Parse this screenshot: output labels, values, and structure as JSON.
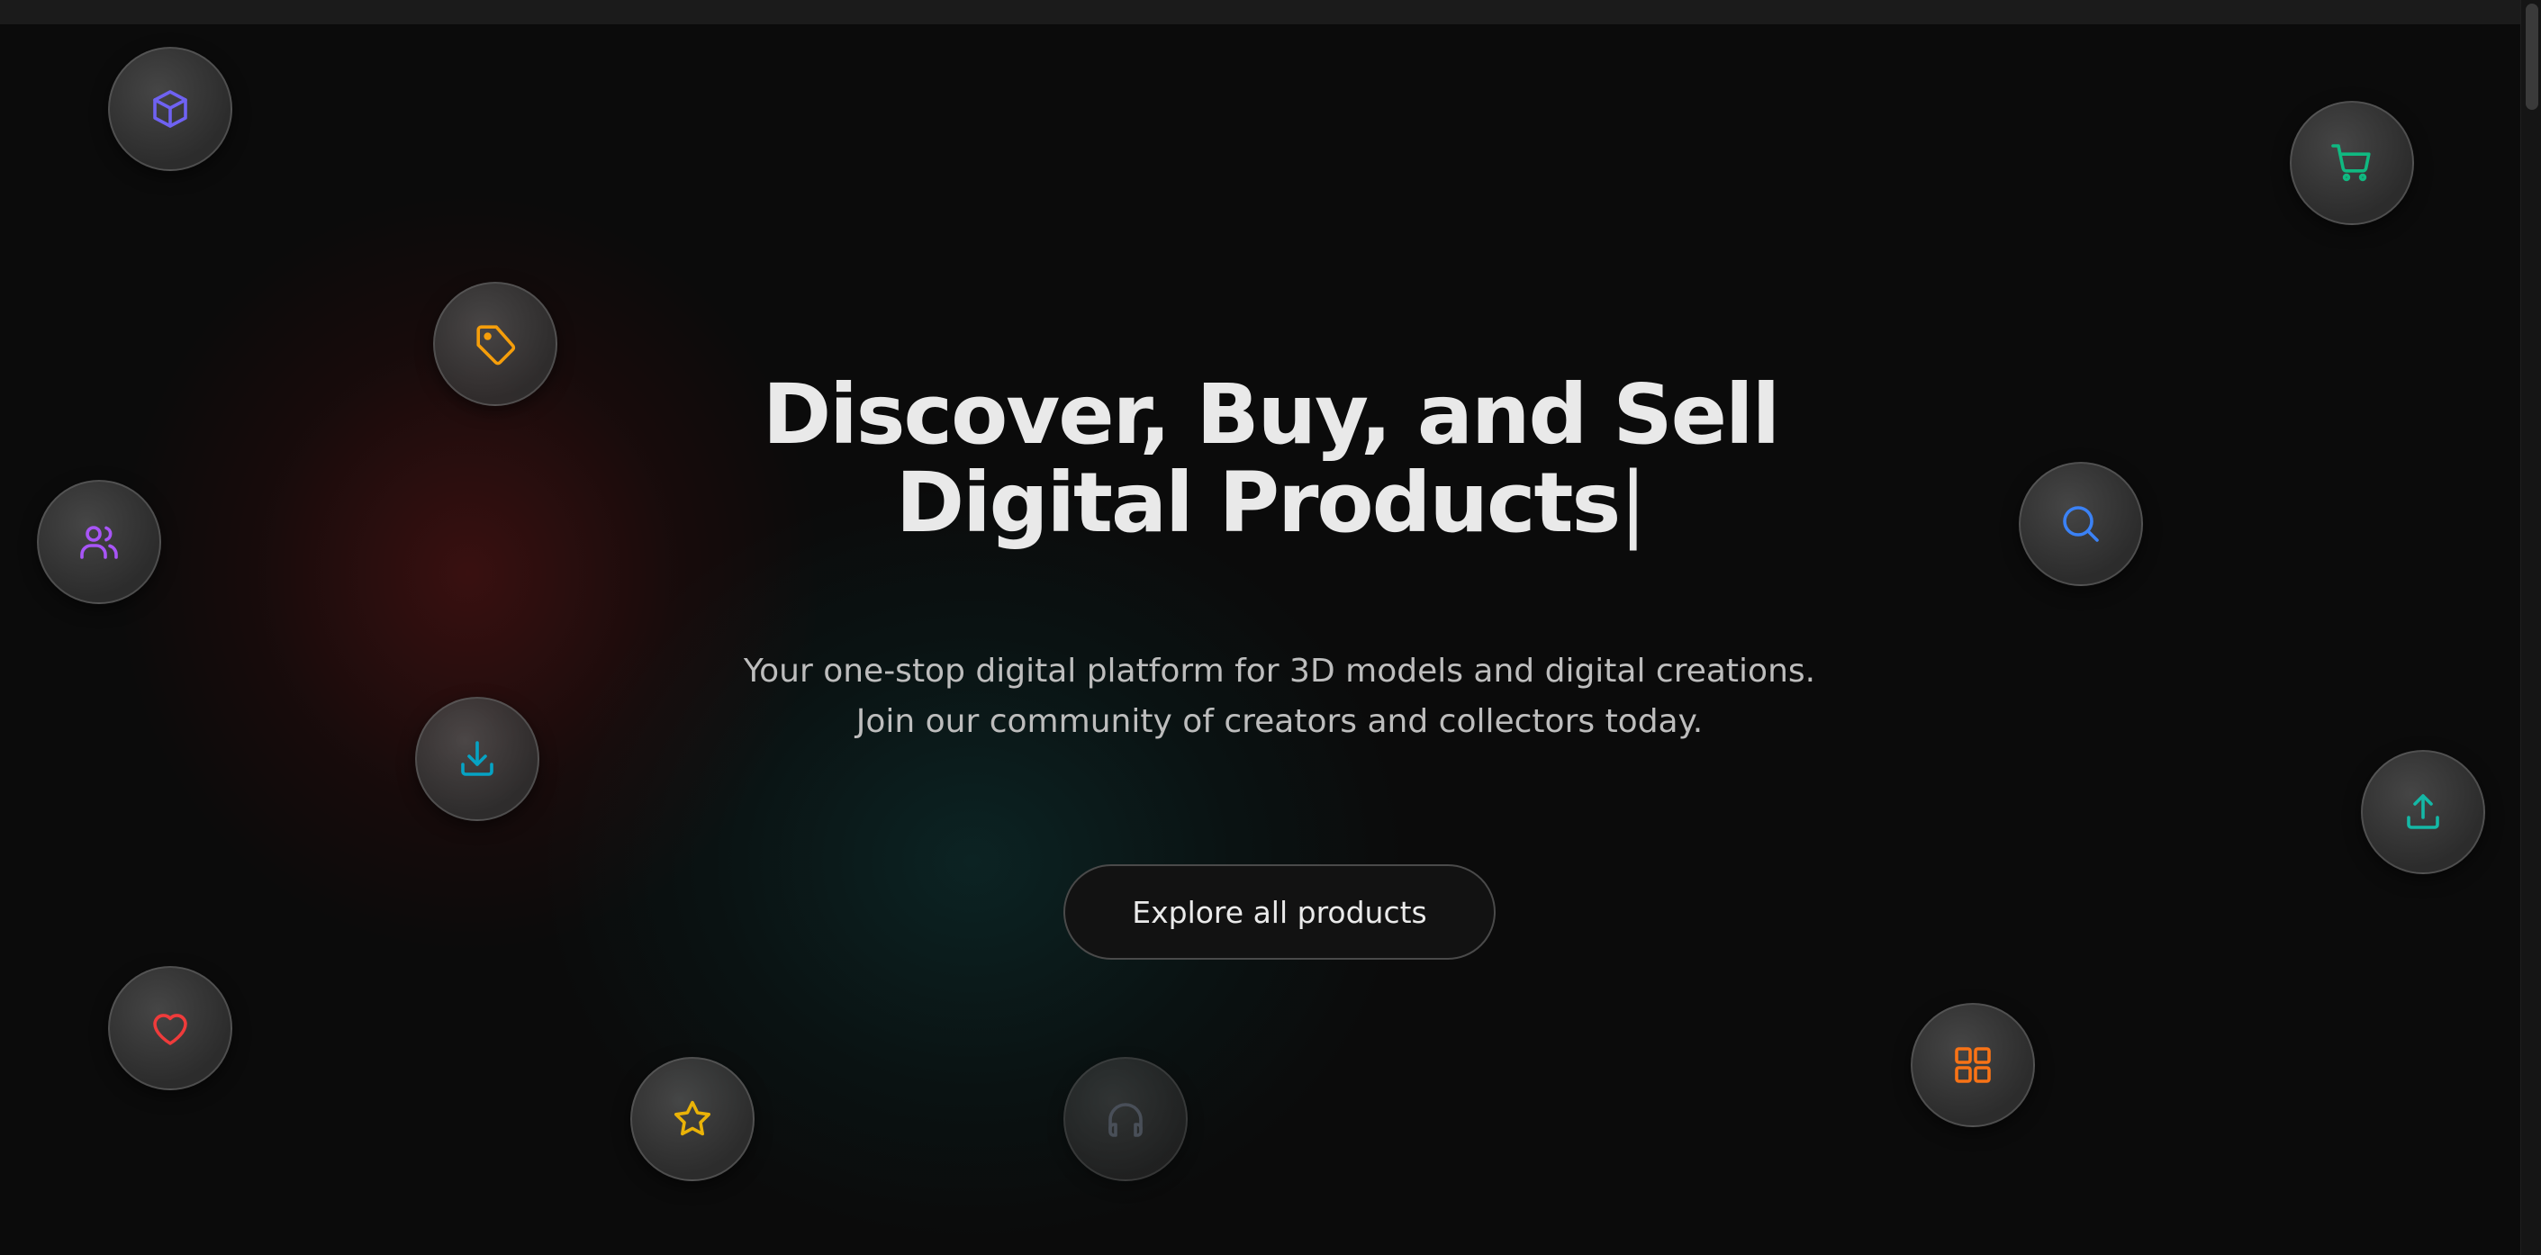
{
  "hero": {
    "headline_line1": "Discover, Buy, and Sell",
    "headline_line2": "Digital Products",
    "cursor": "|",
    "subtitle_line1": "Your one-stop digital platform for 3D models and digital creations.",
    "subtitle_line2": "Join our community of creators and collectors today.",
    "cta_label": "Explore all products"
  },
  "floating_icons": [
    {
      "icon": "cube-icon",
      "color": "#6f62f2"
    },
    {
      "icon": "tag-icon",
      "color": "#f59e0b"
    },
    {
      "icon": "users-icon",
      "color": "#a855f7"
    },
    {
      "icon": "download-icon",
      "color": "#06a3c4"
    },
    {
      "icon": "heart-icon",
      "color": "#ef3b3b"
    },
    {
      "icon": "star-icon",
      "color": "#eab308"
    },
    {
      "icon": "headphones-icon",
      "color": "#6b7280"
    },
    {
      "icon": "cart-icon",
      "color": "#10b981"
    },
    {
      "icon": "search-icon",
      "color": "#3b82f6"
    },
    {
      "icon": "upload-icon",
      "color": "#14b8a6"
    },
    {
      "icon": "grid-icon",
      "color": "#f97316"
    }
  ],
  "colors": {
    "background": "#0b0b0b",
    "text_primary": "#e9e9e9",
    "text_secondary": "#bdbdbd"
  }
}
